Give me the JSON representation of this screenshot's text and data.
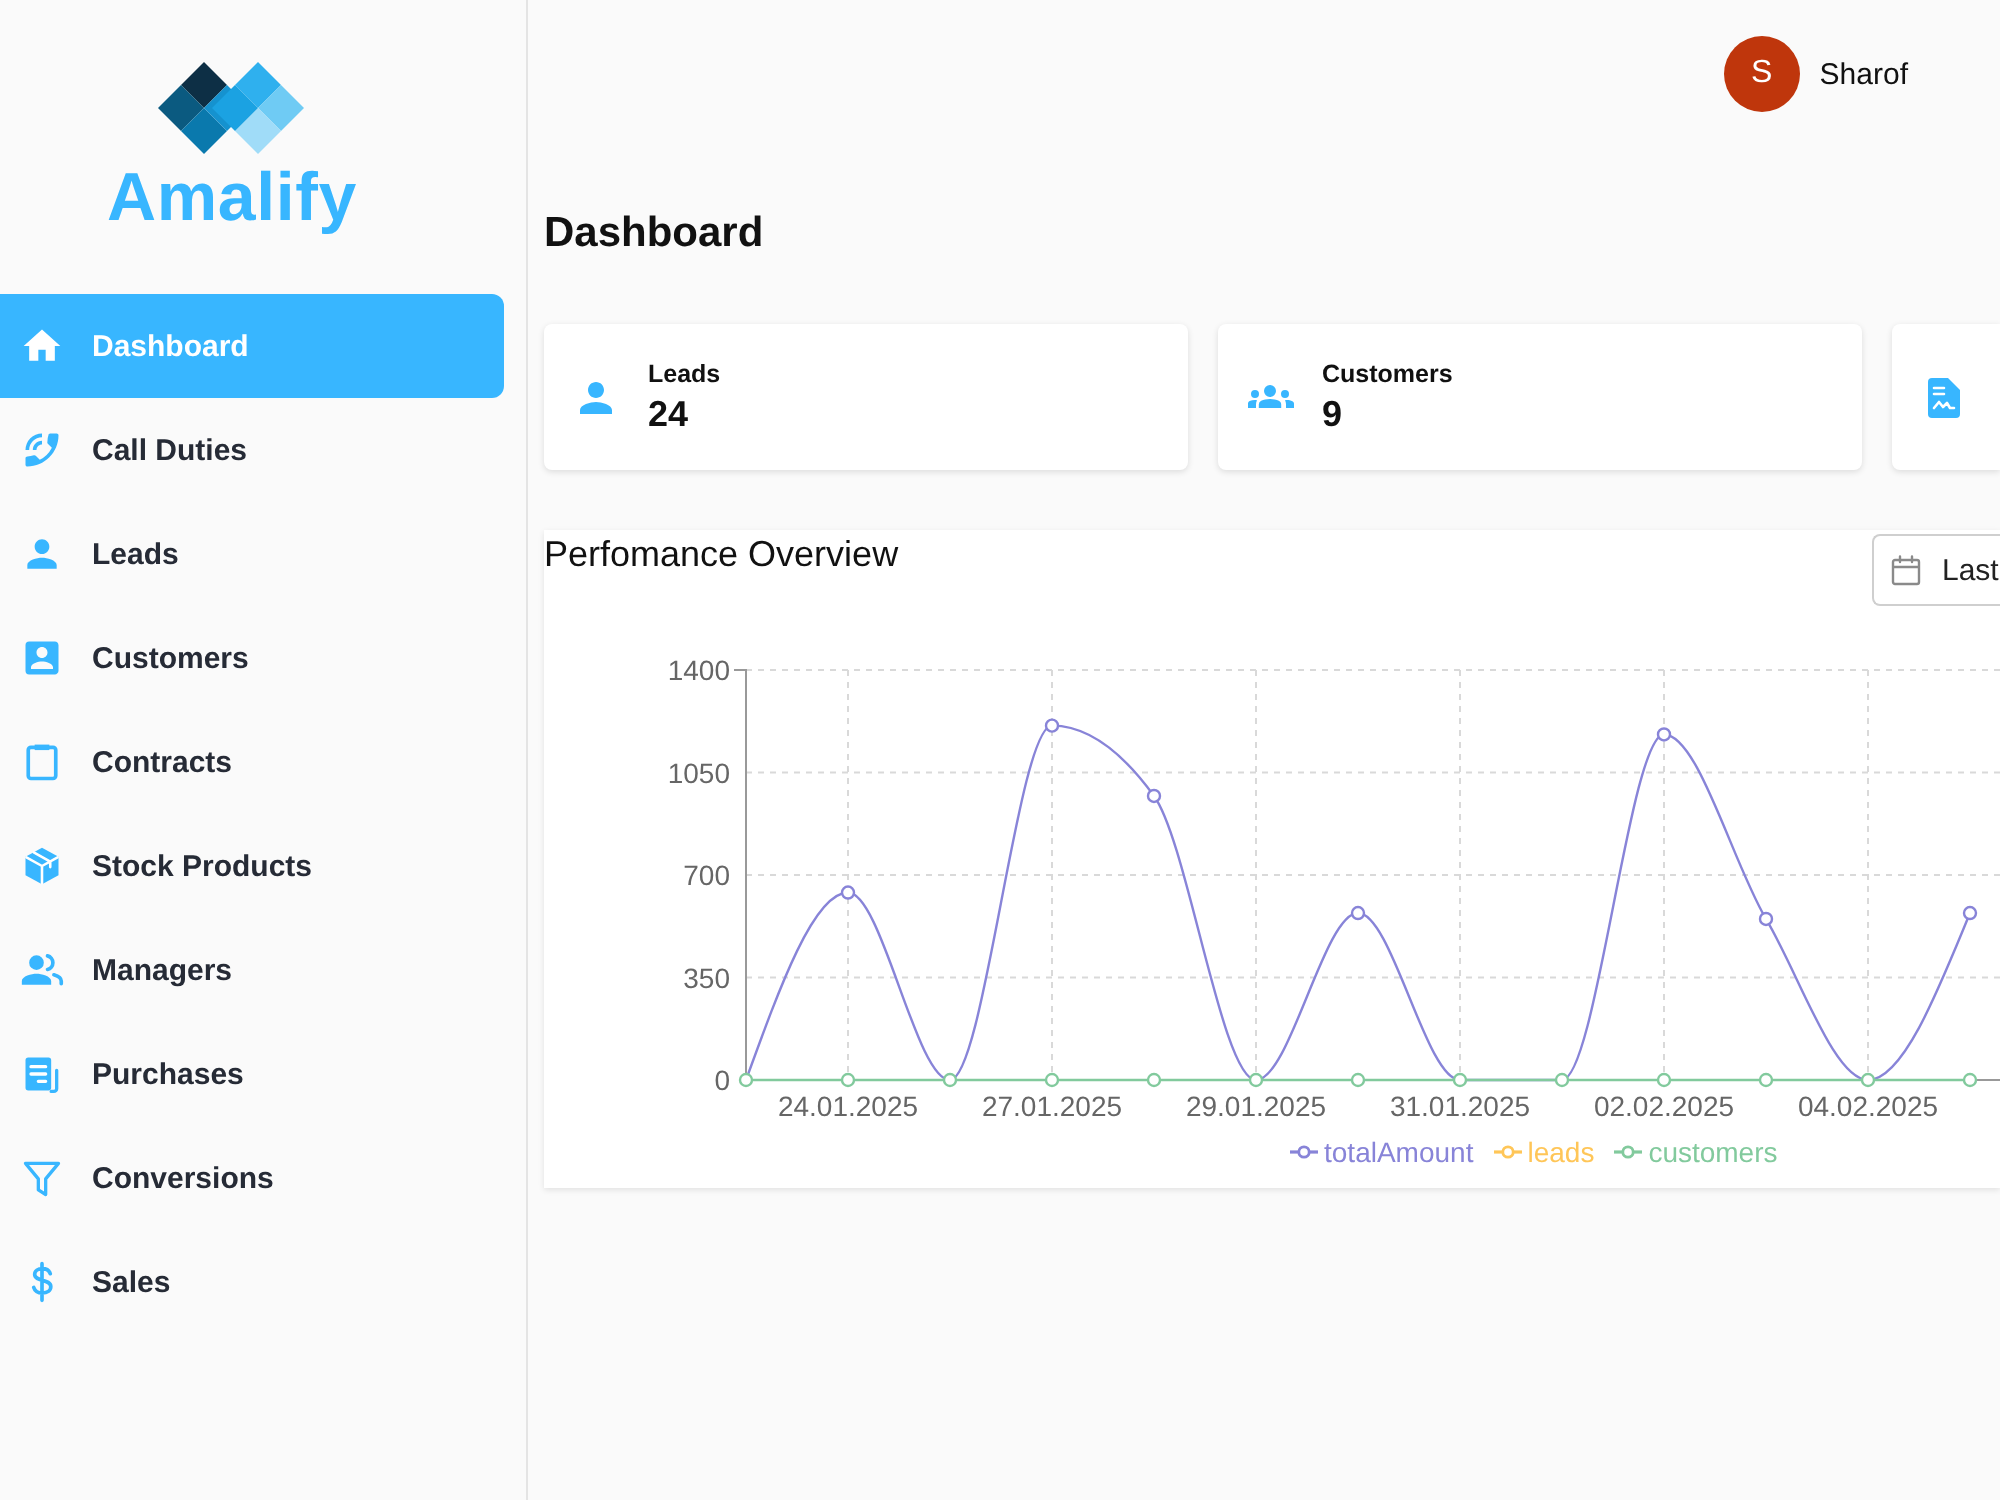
{
  "sidebar": {
    "logo": {
      "text": "Amalify"
    },
    "items": [
      {
        "label": "Dashboard",
        "selected": true
      },
      {
        "label": "Call Duties",
        "selected": false
      },
      {
        "label": "Leads",
        "selected": false
      },
      {
        "label": "Customers",
        "selected": false
      },
      {
        "label": "Contracts",
        "selected": false
      },
      {
        "label": "Stock Products",
        "selected": false
      },
      {
        "label": "Managers",
        "selected": false
      },
      {
        "label": "Purchases",
        "selected": false
      },
      {
        "label": "Conversions",
        "selected": false
      },
      {
        "label": "Sales",
        "selected": false
      }
    ]
  },
  "header": {
    "user": {
      "initial": "S",
      "name": "Sharof"
    }
  },
  "page": {
    "title": "Dashboard"
  },
  "stat_cards": [
    {
      "label": "Leads",
      "value": "24",
      "cut_off": false
    },
    {
      "label": "Customers",
      "value": "9",
      "cut_off": false
    },
    {
      "cut_off": true
    }
  ],
  "performance": {
    "title": "Perfomance Overview",
    "date_range": {
      "label": "Last"
    },
    "chart_data": [
      {
        "type": "line",
        "categories": [
          null,
          "24.01.2025",
          null,
          "27.01.2025",
          null,
          "29.01.2025",
          null,
          "31.01.2025",
          null,
          "02.02.2025",
          null,
          "04.02.2025",
          null
        ],
        "series": [
          {
            "name": "totalAmount",
            "color": "#8884d8",
            "values": [
              0,
              640,
              0,
              1210,
              970,
              0,
              570,
              0,
              0,
              1180,
              550,
              0,
              570
            ]
          },
          {
            "name": "leads",
            "color": "#ffc658",
            "values": [
              null,
              null,
              null,
              null,
              null,
              null,
              null,
              null,
              null,
              null,
              null,
              null,
              null
            ]
          },
          {
            "name": "customers",
            "color": "#82ca9d",
            "values": [
              0,
              0,
              0,
              0,
              0,
              0,
              0,
              0,
              0,
              0,
              0,
              0,
              0
            ]
          }
        ],
        "ylim": [
          0,
          1400
        ],
        "yticks": [
          0,
          350,
          700,
          1050,
          1400
        ],
        "grid": true,
        "legend": "bottom",
        "marker": "circle"
      }
    ]
  }
}
